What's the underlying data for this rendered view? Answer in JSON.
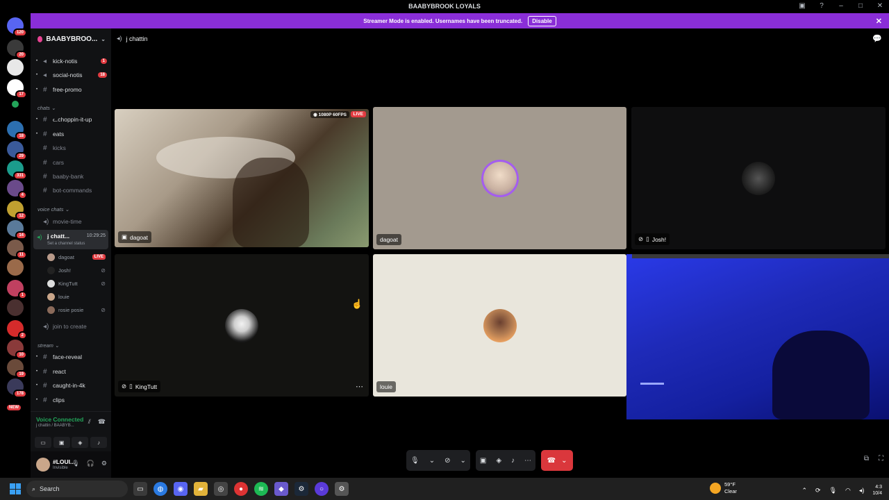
{
  "window": {
    "title": "BAABYBROOK LOYALS"
  },
  "banner": {
    "text": "Streamer Mode is enabled. Usernames have been truncated.",
    "button": "Disable"
  },
  "server": {
    "name": "BAABYBROO..."
  },
  "server_badges": [
    "120",
    "20",
    "17",
    "18",
    "29",
    "331",
    "4",
    "12",
    "14",
    "11",
    "1",
    "2",
    "10",
    "19",
    "178",
    "NEW"
  ],
  "channels": {
    "top": [
      {
        "label": "kick-notis",
        "count": "1"
      },
      {
        "label": "social-notis",
        "count": "18"
      },
      {
        "label": "free-promo"
      }
    ],
    "cat_chats": "chats",
    "chats": [
      {
        "label": "ᓚchoppin-it-up"
      },
      {
        "label": "eats"
      },
      {
        "label": "kicks"
      },
      {
        "label": "cars"
      },
      {
        "label": "baaby-bank"
      },
      {
        "label": "bot-commands"
      }
    ],
    "cat_voice": "voice chats",
    "voice": [
      {
        "label": "movie-time"
      }
    ],
    "active_voice": {
      "name": "j chatt...",
      "time": "10:29:25",
      "status": "Set a channel status"
    },
    "voice_users": [
      {
        "name": "dagoat",
        "live": "LIVE"
      },
      {
        "name": "Josh!"
      },
      {
        "name": "KingTutt"
      },
      {
        "name": "louie"
      },
      {
        "name": "rosie posie"
      }
    ],
    "join": "join to create",
    "cat_stream": "stream",
    "stream": [
      {
        "label": "face-reveal"
      },
      {
        "label": "react"
      },
      {
        "label": "caught-in-4k"
      },
      {
        "label": "clips"
      }
    ]
  },
  "voice_panel": {
    "title": "Voice Connected",
    "subtitle": "j chattin / BAABYB..."
  },
  "user": {
    "name": "#LOUI...",
    "status": "Invisible"
  },
  "stage": {
    "channel": "j chattin",
    "tiles": [
      {
        "name": "dagoat",
        "quality": "1080P 60FPS",
        "live": "LIVE"
      },
      {
        "name": "dagoat"
      },
      {
        "name": "Josh!"
      },
      {
        "name": "KingTutt"
      },
      {
        "name": "louie"
      }
    ]
  },
  "taskbar": {
    "search": "Search",
    "temp": "59°F",
    "weather": "Clear",
    "time": "4:3",
    "date": "10/4"
  },
  "colors": {
    "accent": "#8a2ed8",
    "live": "#e23b41",
    "voice_green": "#23a55a",
    "end_call": "#da373c"
  }
}
